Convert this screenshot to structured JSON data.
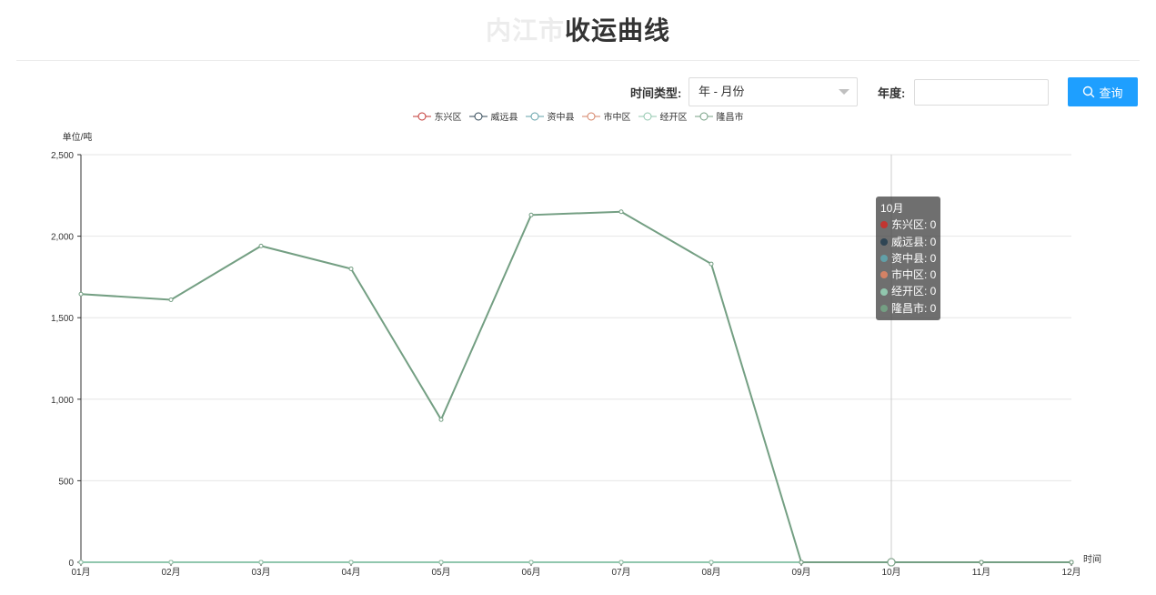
{
  "header": {
    "title_city": "内江市",
    "title_main": "收运曲线"
  },
  "filters": {
    "time_type_label": "时间类型:",
    "time_type_value": "年 - 月份",
    "year_label": "年度:",
    "year_value": "",
    "query_label": "查询"
  },
  "chart_data": {
    "type": "line",
    "ylabel": "单位/吨",
    "xlabel": "时间",
    "ylim": [
      0,
      2500
    ],
    "yticks": [
      0,
      500,
      1000,
      1500,
      2000,
      2500
    ],
    "ytick_labels": [
      "0",
      "500",
      "1,000",
      "1,500",
      "2,000",
      "2,500"
    ],
    "categories": [
      "01月",
      "02月",
      "03月",
      "04月",
      "05月",
      "06月",
      "07月",
      "08月",
      "09月",
      "10月",
      "11月",
      "12月"
    ],
    "legend_position": "top-center",
    "grid": true,
    "series": [
      {
        "name": "东兴区",
        "color": "#c23531",
        "values": [
          0,
          0,
          0,
          0,
          0,
          0,
          0,
          0,
          0,
          0,
          0,
          0
        ]
      },
      {
        "name": "威远县",
        "color": "#2f4554",
        "values": [
          0,
          0,
          0,
          0,
          0,
          0,
          0,
          0,
          0,
          0,
          0,
          0
        ]
      },
      {
        "name": "资中县",
        "color": "#61a0a8",
        "values": [
          0,
          0,
          0,
          0,
          0,
          0,
          0,
          0,
          0,
          0,
          0,
          0
        ]
      },
      {
        "name": "市中区",
        "color": "#d48265",
        "values": [
          0,
          0,
          0,
          0,
          0,
          0,
          0,
          0,
          0,
          0,
          0,
          0
        ]
      },
      {
        "name": "经开区",
        "color": "#91c7ae",
        "values": [
          0,
          0,
          0,
          0,
          0,
          0,
          0,
          0,
          0,
          0,
          0,
          0
        ]
      },
      {
        "name": "隆昌市",
        "color": "#749f83",
        "values": [
          1645,
          1610,
          1940,
          1800,
          875,
          2130,
          2150,
          1830,
          0,
          0,
          0,
          0
        ]
      }
    ],
    "tooltip": {
      "title": "10月",
      "rows": [
        {
          "text": "东兴区: 0",
          "color": "#c23531"
        },
        {
          "text": "威远县: 0",
          "color": "#2f4554"
        },
        {
          "text": "资中县: 0",
          "color": "#61a0a8"
        },
        {
          "text": "市中区: 0",
          "color": "#d48265"
        },
        {
          "text": "经开区: 0",
          "color": "#91c7ae"
        },
        {
          "text": "隆昌市: 0",
          "color": "#749f83"
        }
      ],
      "category_index": 9
    }
  }
}
